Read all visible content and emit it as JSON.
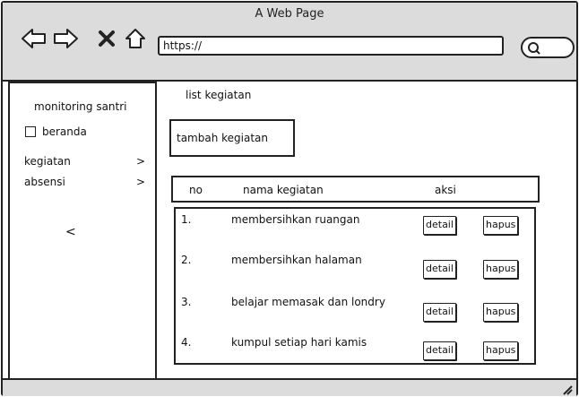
{
  "browser": {
    "title": "A Web Page",
    "url": "https://",
    "icons": [
      "back-arrow-icon",
      "forward-arrow-icon",
      "close-x-icon",
      "home-icon",
      "search-icon"
    ]
  },
  "sidebar": {
    "title": "monitoring santri",
    "checkbox_label": "beranda",
    "items": [
      {
        "label": "kegiatan",
        "chevron": ">"
      },
      {
        "label": "absensi",
        "chevron": ">"
      }
    ],
    "collapse": "<"
  },
  "main": {
    "title": "list kegiatan",
    "add_button": "tambah kegiatan",
    "table": {
      "columns": [
        "no",
        "nama kegiatan",
        "aksi"
      ],
      "rows": [
        {
          "no": "1.",
          "name": "membersihkan ruangan",
          "detail": "detail",
          "delete": "hapus"
        },
        {
          "no": "2.",
          "name": "membersihkan halaman",
          "detail": "detail",
          "delete": "hapus"
        },
        {
          "no": "3.",
          "name": "belajar memasak dan londry",
          "detail": "detail",
          "delete": "hapus"
        },
        {
          "no": "4.",
          "name": "kumpul setiap hari kamis",
          "detail": "detail",
          "delete": "hapus"
        }
      ]
    }
  }
}
